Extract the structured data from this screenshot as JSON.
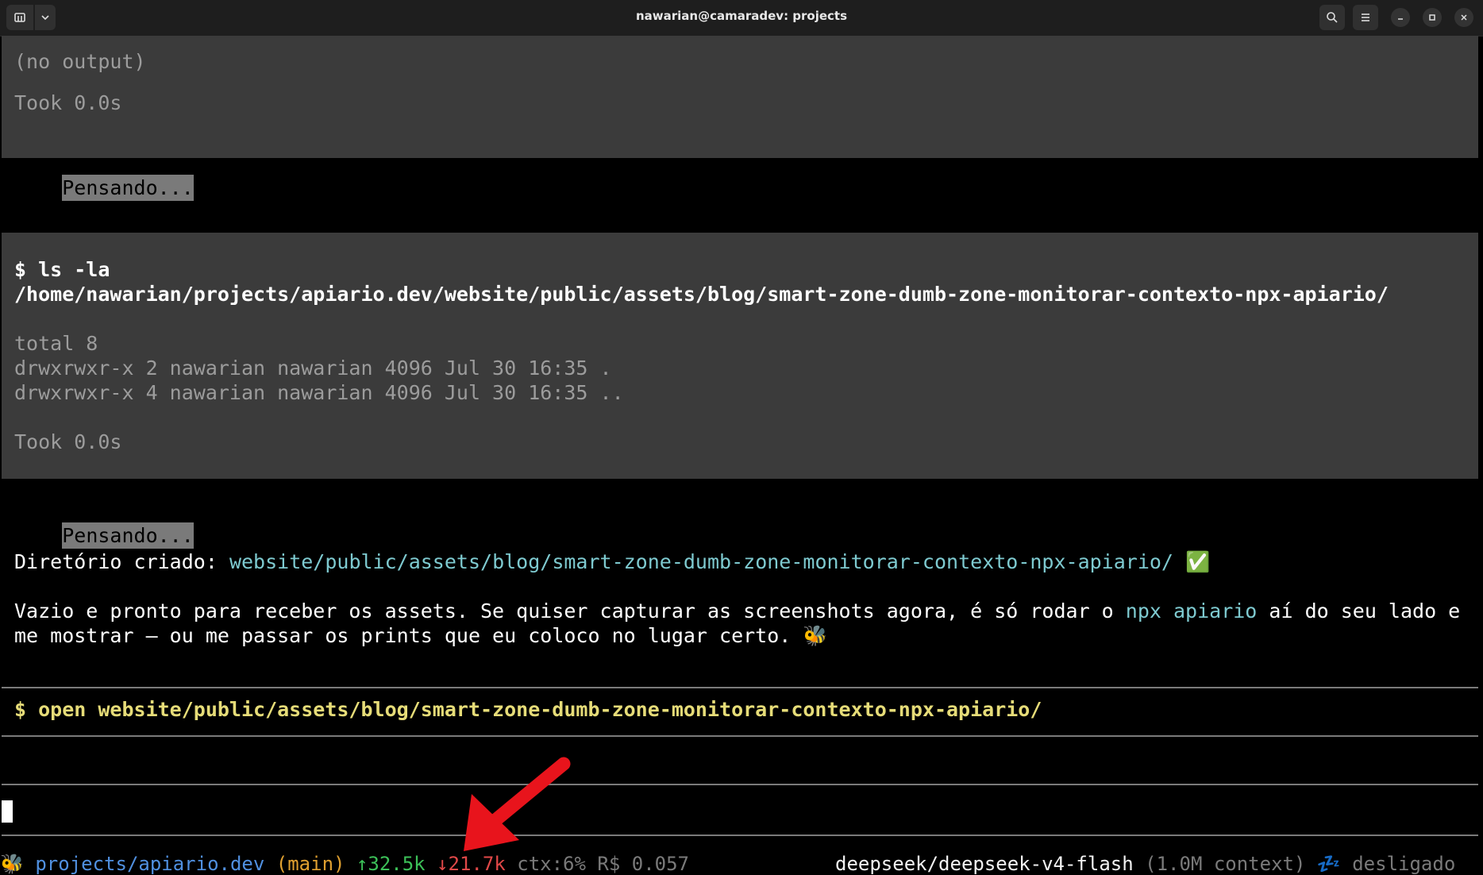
{
  "window": {
    "title": "nawarian@camaradev: projects"
  },
  "output1": {
    "result": "(no output)",
    "took": "Took 0.0s"
  },
  "thinking1": "Pensando...",
  "command2": {
    "line1": "$ ls -la",
    "line2": "/home/nawarian/projects/apiario.dev/website/public/assets/blog/smart-zone-dumb-zone-monitorar-contexto-npx-apiario/",
    "out1": "total 8",
    "out2": "drwxrwxr-x 2 nawarian nawarian 4096 Jul 30 16:35 .",
    "out3": "drwxrwxr-x 4 nawarian nawarian 4096 Jul 30 16:35 ..",
    "took": "Took 0.0s"
  },
  "thinking2": "Pensando...",
  "message": {
    "created_label": "Diretório criado: ",
    "created_path": "website/public/assets/blog/smart-zone-dumb-zone-monitorar-contexto-npx-apiario/",
    "check": "✅",
    "para1_a": "Vazio e pronto para receber os assets. Se quiser capturar as screenshots agora, é só rodar o ",
    "para1_cmd": "npx apiario",
    "para1_b": " aí do seu lado e",
    "para2": "me mostrar — ou me passar os prints que eu coloco no lugar certo. ",
    "bee": "🐝"
  },
  "pending_command": "$ open website/public/assets/blog/smart-zone-dumb-zone-monitorar-contexto-npx-apiario/",
  "status": {
    "bee": "🐝",
    "path": "projects/apiario.dev",
    "branch": "(main)",
    "up": "↑32.5k",
    "down": "↓21.7k",
    "ctx": "ctx:6%",
    "cost": "R$ 0.057",
    "model": "deepseek/deepseek-v4-flash",
    "context": "(1.0M context)",
    "sleep": "💤",
    "state": "desligado"
  },
  "colors": {
    "panel": "#3b3b3b",
    "teal": "#7ecad0",
    "yellow": "#e6dc78",
    "arrow": "#e8141c"
  }
}
